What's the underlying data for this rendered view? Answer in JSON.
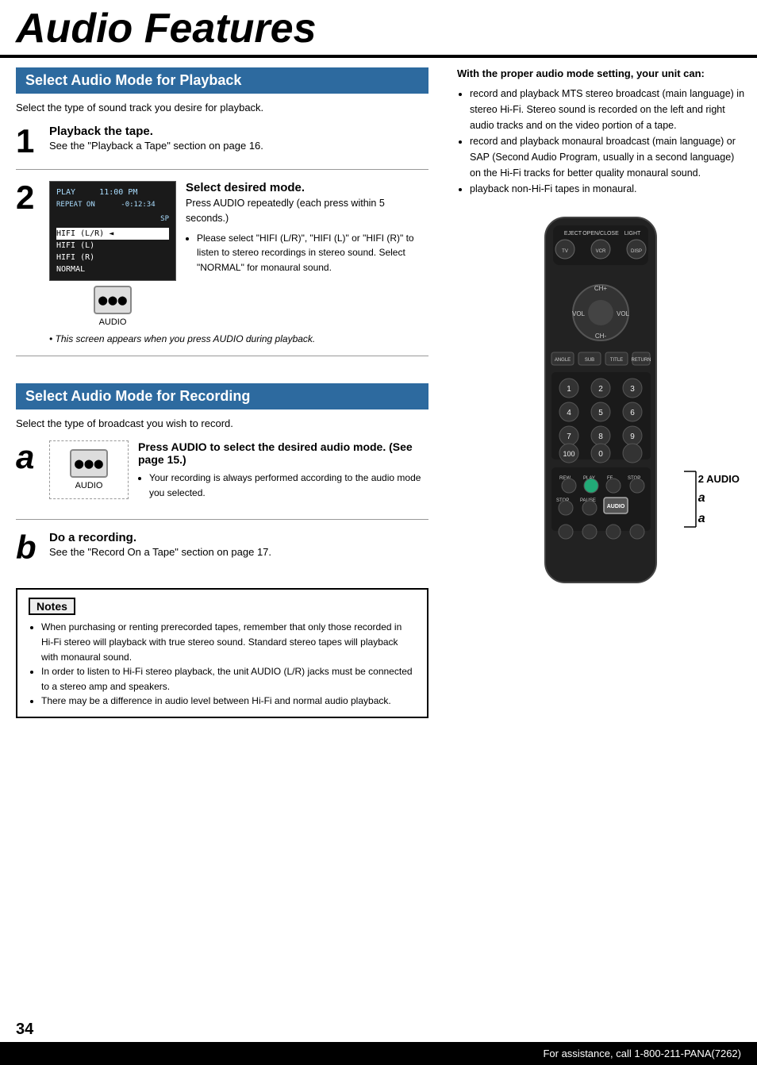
{
  "page": {
    "title": "Audio Features",
    "page_number": "34",
    "footer_text": "For assistance, call 1-800-211-PANA(7262)"
  },
  "section1": {
    "header": "Select Audio Mode for Playback",
    "intro": "Select the type of sound track you desire for playback.",
    "step1": {
      "number": "1",
      "title": "Playback the tape.",
      "desc": "See the \"Playback a Tape\" section on page 16."
    },
    "step2": {
      "number": "2",
      "title": "Select desired mode.",
      "desc1": "Press AUDIO repeatedly (each press within 5 seconds.)",
      "bullet1": "Please select \"HIFI (L/R)\", \"HIFI (L)\" or \"HIFI (R)\" to listen to stereo recordings in stereo sound. Select \"NORMAL\" for monaural sound.",
      "screen_note": "• This screen appears when you press AUDIO during playback.",
      "vcr_lines": {
        "line1": "PLAY    11:00 PM",
        "line2": "REPEAT ON      -0:12:34",
        "line3": "                        SP",
        "menu_items": [
          "HIFI (L/R) ◄",
          "HIFI (L)",
          "HIFI (R)",
          "NORMAL"
        ]
      },
      "audio_label": "AUDIO"
    }
  },
  "section2": {
    "header": "Select Audio Mode for Recording",
    "intro": "Select the type of broadcast you wish to record.",
    "step_a": {
      "letter": "a",
      "title": "Press AUDIO to select the desired audio mode.",
      "see": "(See page 15.)",
      "bullet1": "Your recording is always performed according to the audio mode you selected.",
      "audio_label": "AUDIO"
    },
    "step_b": {
      "letter": "b",
      "title": "Do a recording.",
      "desc": "See the \"Record On a Tape\" section on page 17."
    }
  },
  "notes": {
    "title": "Notes",
    "items": [
      "When purchasing or renting prerecorded tapes, remember that only those recorded in Hi-Fi stereo will playback with true stereo sound. Standard stereo tapes will playback with monaural sound.",
      "In order to listen to Hi-Fi stereo playback, the unit AUDIO (L/R) jacks must be connected to a stereo amp and speakers.",
      "There may be a difference in audio level between Hi-Fi and normal audio playback."
    ]
  },
  "right_col": {
    "intro": "With the proper audio mode setting, your unit can:",
    "bullets": [
      "record and playback MTS stereo broadcast (main language) in stereo Hi-Fi. Stereo sound is recorded on the left and right audio tracks and on the video portion of a tape.",
      "record and playback monaural broadcast (main language) or SAP (Second Audio Program, usually in a second language) on the Hi-Fi tracks for better quality monaural sound.",
      "playback non-Hi-Fi tapes in monaural."
    ],
    "remote_labels": {
      "audio_2": "2 AUDIO",
      "audio_a": "a"
    }
  }
}
